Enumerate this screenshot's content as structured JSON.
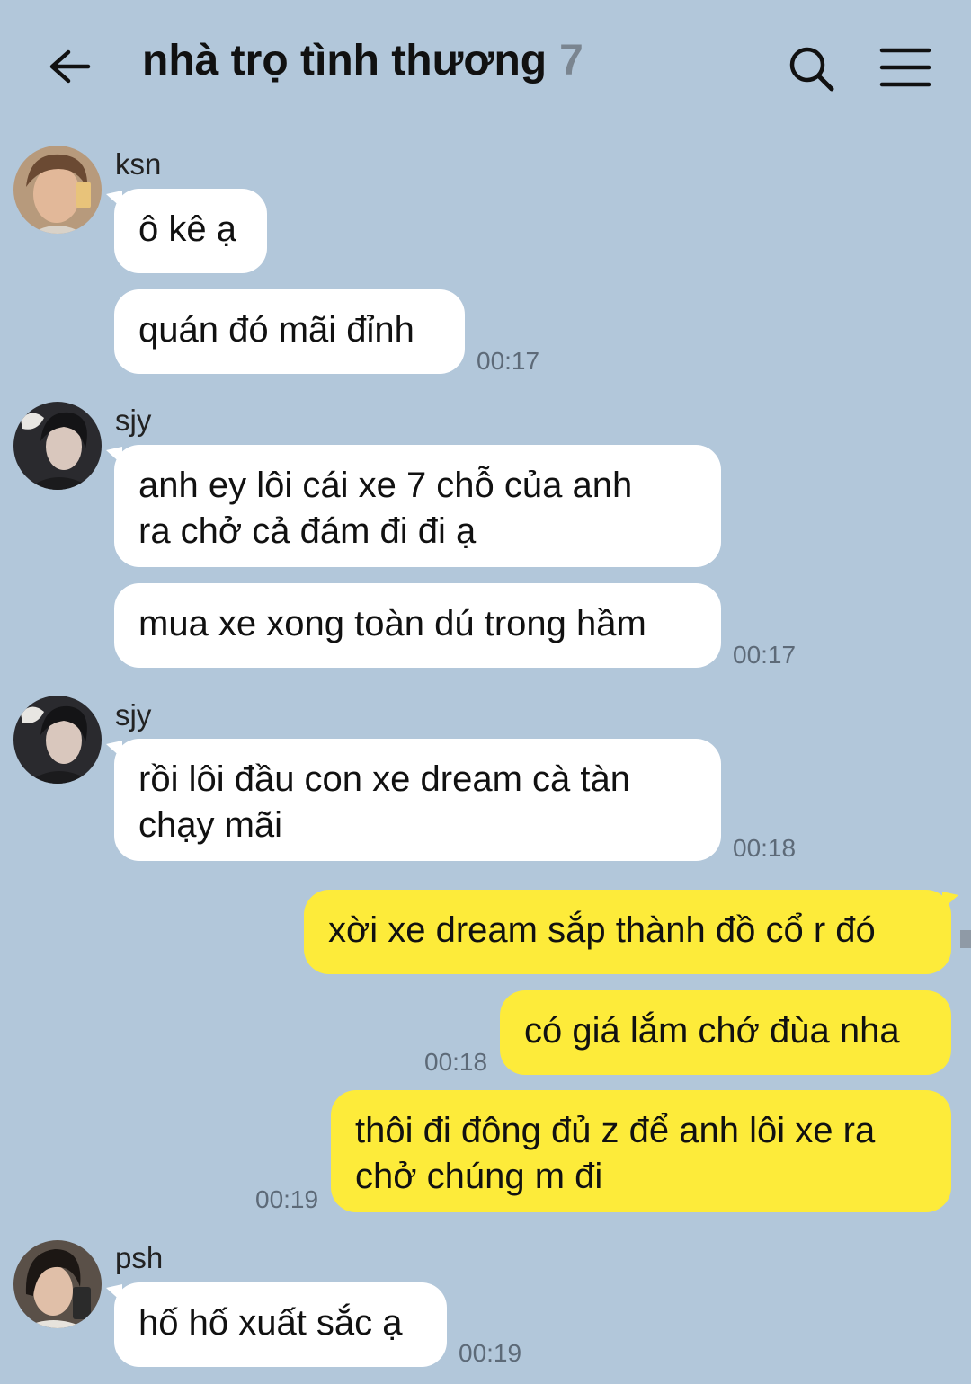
{
  "header": {
    "title": "nhà trọ tình thương",
    "member_count": "7"
  },
  "messages": {
    "m1": {
      "sender": "ksn",
      "text": "ô kê ạ"
    },
    "m2": {
      "text": "quán đó mãi đỉnh",
      "time": "00:17"
    },
    "m3": {
      "sender": "sjy",
      "line1": "anh ey lôi cái xe 7 chỗ của anh",
      "line2": "ra chở cả đám đi đi ạ"
    },
    "m4": {
      "text": "mua xe xong toàn dú trong hầm",
      "time": "00:17"
    },
    "m5": {
      "sender": "sjy",
      "line1": "rồi lôi đầu con xe dream cà tàn",
      "line2": "chạy mãi",
      "time": "00:18"
    },
    "m6": {
      "text": "xời xe dream sắp thành đồ cổ r đó"
    },
    "m7": {
      "text": "có giá lắm chớ đùa nha",
      "time": "00:18"
    },
    "m8": {
      "line1": "thôi đi đông đủ z để anh lôi xe ra",
      "line2": "chở chúng m đi",
      "time": "00:19"
    },
    "m9": {
      "sender": "psh",
      "text": "hố hố xuất sắc ạ",
      "time": "00:19"
    }
  },
  "colors": {
    "background": "#b2c7da",
    "incoming_bubble": "#ffffff",
    "outgoing_bubble": "#fdeb3a"
  },
  "icons": [
    "back-arrow-icon",
    "search-icon",
    "menu-icon"
  ]
}
